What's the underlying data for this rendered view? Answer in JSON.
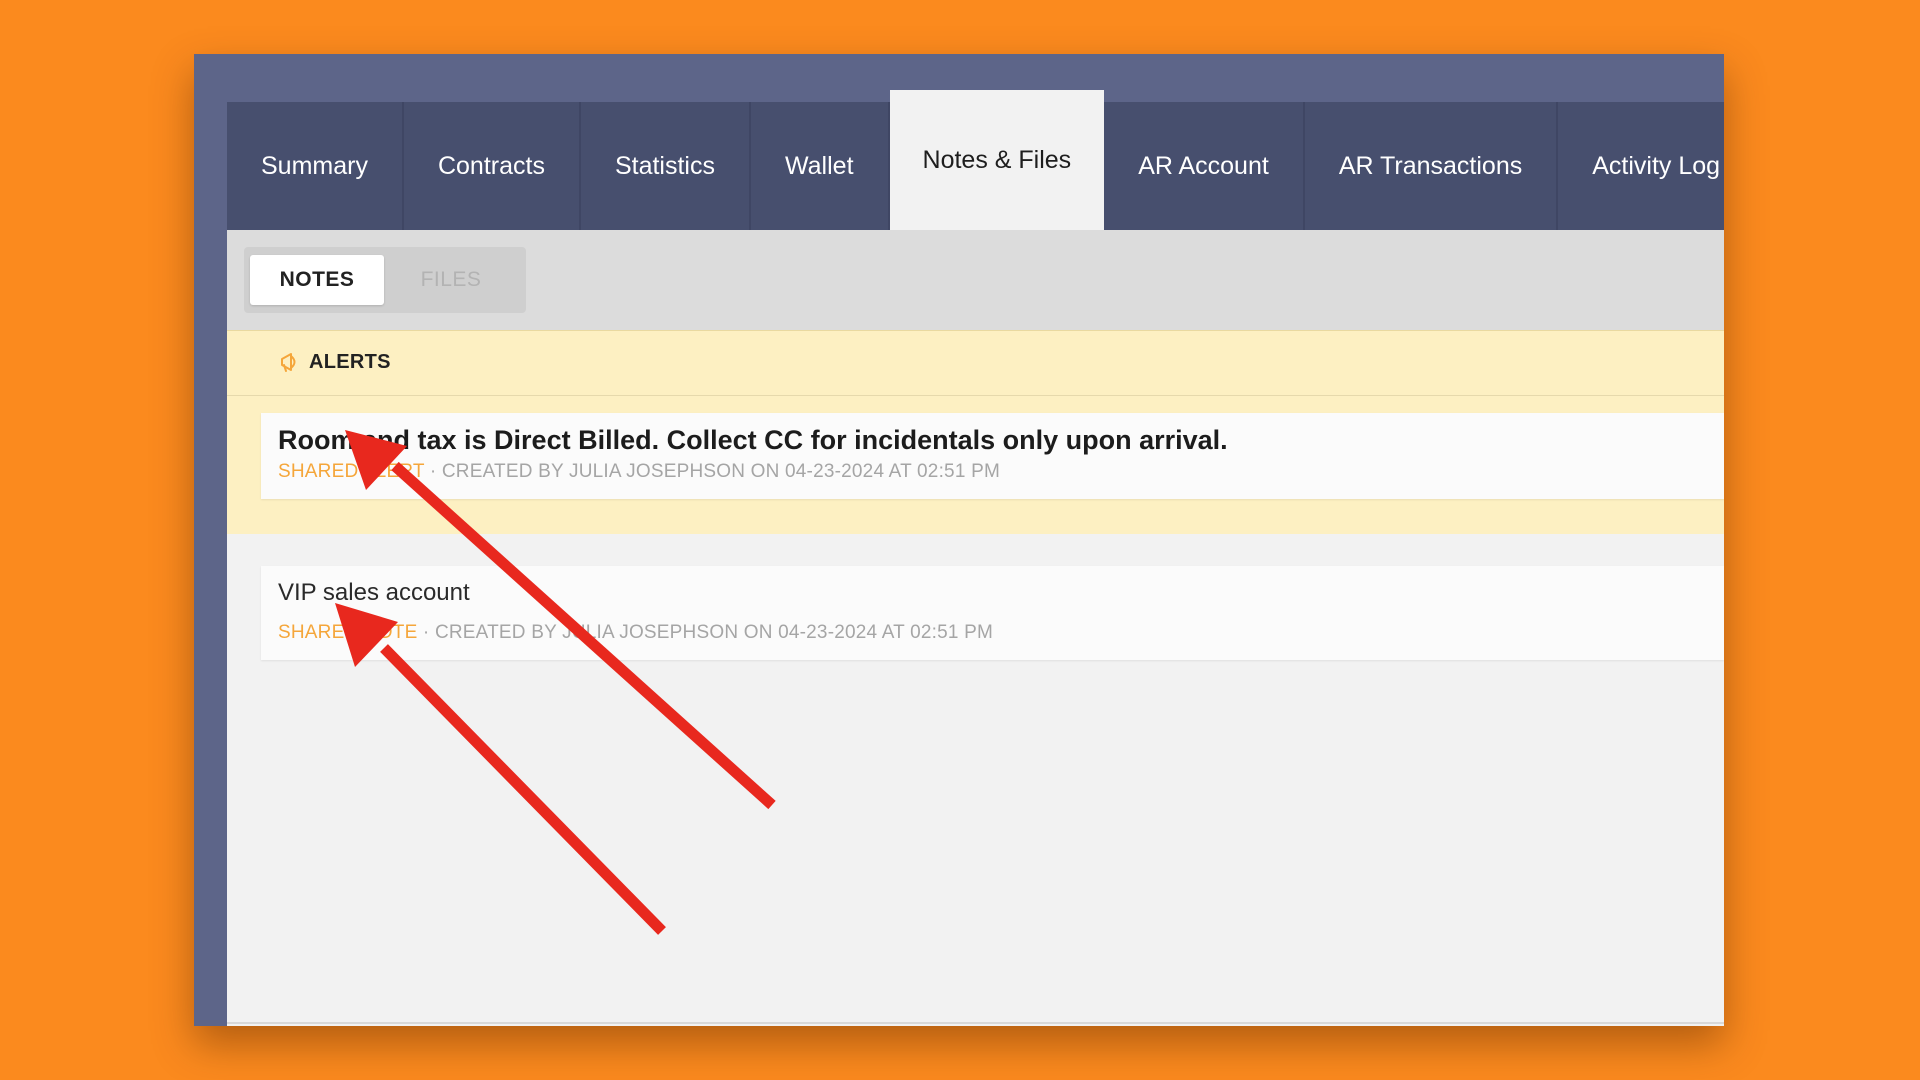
{
  "tabs": [
    {
      "label": "Summary",
      "active": false
    },
    {
      "label": "Contracts",
      "active": false
    },
    {
      "label": "Statistics",
      "active": false
    },
    {
      "label": "Wallet",
      "active": false
    },
    {
      "label": "Notes & Files",
      "active": true
    },
    {
      "label": "AR Account",
      "active": false
    },
    {
      "label": "AR Transactions",
      "active": false
    },
    {
      "label": "Activity Log",
      "active": false
    }
  ],
  "toggle": {
    "notes_label": "NOTES",
    "files_label": "FILES",
    "selected": "NOTES"
  },
  "alerts": {
    "header": "ALERTS",
    "items": [
      {
        "text": "Room and tax is Direct Billed. Collect CC for incidentals only upon arrival.",
        "tag": "SHARED ALERT",
        "meta": " · CREATED BY JULIA JOSEPHSON ON 04-23-2024 AT 02:51 PM"
      }
    ]
  },
  "notes": {
    "items": [
      {
        "text": "VIP sales account",
        "tag": "SHARED NOTE",
        "meta": " · CREATED BY JULIA JOSEPHSON ON 04-23-2024 AT 02:51 PM"
      }
    ]
  },
  "colors": {
    "background": "#fb8a1e",
    "tab_bar": "#474f6e",
    "alert_bg": "#fdf0c2",
    "tag": "#f5a63a",
    "annotation_arrow": "#e8281e"
  },
  "icons": {
    "alerts": "megaphone-icon"
  }
}
